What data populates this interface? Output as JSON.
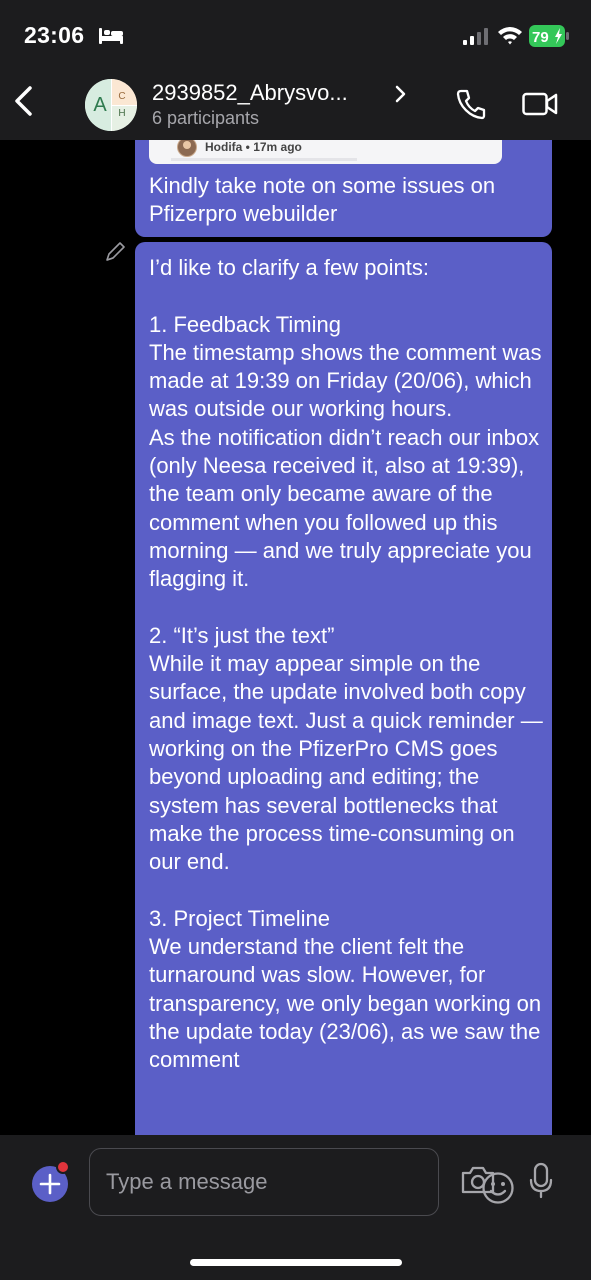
{
  "status_bar": {
    "time": "23:06",
    "battery": "79"
  },
  "header": {
    "title": "2939852_Abrysvo...",
    "subtitle": "6 participants",
    "avatar_letters": [
      "A",
      "C",
      "H"
    ]
  },
  "messages": [
    {
      "quote_author": "Hodifa • 17m ago",
      "text": "Kindly take note on some issues on Pfizerpro webuilder"
    },
    {
      "text": "I’d like to clarify a few points:\n\n1. Feedback Timing\nThe timestamp shows the comment was made at 19:39 on Friday (20/06), which was outside our working hours.\nAs the notification didn’t reach our inbox (only Neesa received it, also at 19:39), the team only became aware of the comment when you followed up this morning — and we truly appreciate you flagging it.\n\n2. “It’s just the text”\nWhile it may appear simple on the surface, the update involved both copy and image text. Just a quick reminder — working on the PfizerPro CMS goes beyond uploading and editing; the system has several bottlenecks that make the process time-consuming on our end.\n\n3. Project Timeline\nWe understand the client felt the turnaround was slow. However, for transparency, we only began working on the update today (23/06), as we saw the comment"
    }
  ],
  "compose": {
    "placeholder": "Type a message"
  },
  "colors": {
    "accent": "#5b5fc7",
    "header_bg": "#1c1c1e",
    "notification": "#e0343c",
    "battery": "#34c759"
  },
  "icons": [
    "bed-icon",
    "signal-icon",
    "wifi-icon",
    "battery-icon",
    "back-icon",
    "chevron-right-icon",
    "phone-icon",
    "video-icon",
    "edit-icon",
    "plus-icon",
    "emoji-icon",
    "camera-icon",
    "microphone-icon"
  ]
}
